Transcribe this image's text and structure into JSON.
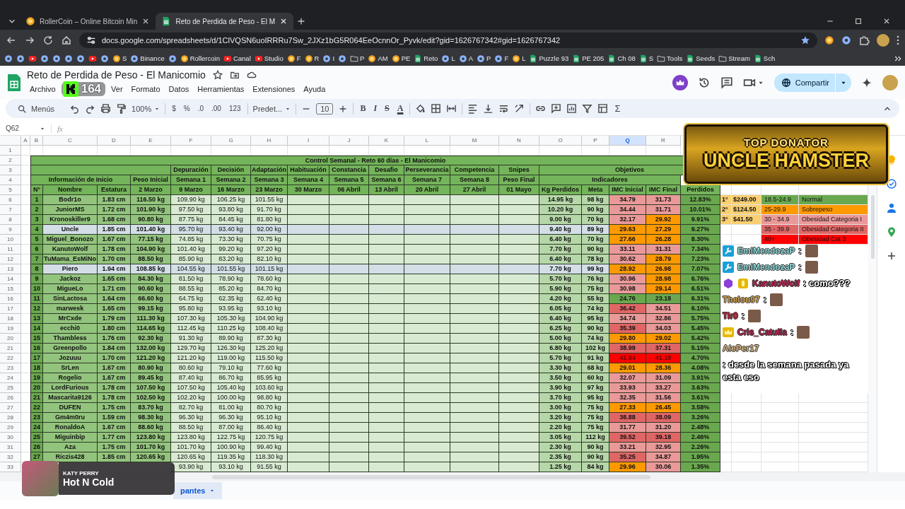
{
  "browser": {
    "tabs": [
      {
        "title": "RollerCoin – Online Bitcoin Min",
        "kind": "coin",
        "selected": false
      },
      {
        "title": "Reto de Perdida de Peso - El M",
        "kind": "sheet",
        "selected": true
      }
    ],
    "url": "docs.google.com/spreadsheets/d/1ClVQSN6uoIRRRu7Sw_2JXz1bG5R064EeOcnnOr_Pyvk/edit?gid=1626767342#gid=1626767342",
    "bookmarks": [
      {
        "kind": "site"
      },
      {
        "kind": "site"
      },
      {
        "kind": "video"
      },
      {
        "kind": "site"
      },
      {
        "kind": "site"
      },
      {
        "kind": "site"
      },
      {
        "kind": "site"
      },
      {
        "kind": "video"
      },
      {
        "kind": "site"
      },
      {
        "kind": "coin",
        "label": "S"
      },
      {
        "kind": "site",
        "label": "Binance"
      },
      {
        "kind": "site"
      },
      {
        "kind": "coin",
        "label": "Rollercoin"
      },
      {
        "kind": "video",
        "label": "Canal"
      },
      {
        "kind": "video",
        "label": "Studio"
      },
      {
        "kind": "coin",
        "label": "F"
      },
      {
        "kind": "coin",
        "label": "R"
      },
      {
        "kind": "site",
        "label": "I"
      },
      {
        "kind": "site"
      },
      {
        "kind": "folder",
        "label": "P"
      },
      {
        "kind": "coin",
        "label": "AM"
      },
      {
        "kind": "coin",
        "label": "PE"
      },
      {
        "kind": "sheet",
        "label": "Reto"
      },
      {
        "kind": "site",
        "label": "L"
      },
      {
        "kind": "site",
        "label": "A"
      },
      {
        "kind": "site",
        "label": "P"
      },
      {
        "kind": "site",
        "label": "F"
      },
      {
        "kind": "coin",
        "label": "L"
      },
      {
        "kind": "sheet",
        "label": "Puzzle 93"
      },
      {
        "kind": "sheet",
        "label": "PE 205"
      },
      {
        "kind": "sheet",
        "label": "Ch 08"
      },
      {
        "kind": "sheet",
        "label": "S"
      },
      {
        "kind": "folder",
        "label": "Tools"
      },
      {
        "kind": "sheet",
        "label": "Seeds"
      },
      {
        "kind": "folder",
        "label": "Stream"
      },
      {
        "kind": "sheet",
        "label": "Sch"
      }
    ]
  },
  "stream": {
    "viewer_count": "164"
  },
  "sheets": {
    "title": "Reto de Perdida de Peso - El Manicomio",
    "menus": [
      "Archivo",
      "Ver",
      "Formato",
      "Datos",
      "Herramientas",
      "Extensiones",
      "Ayuda"
    ],
    "share": "Compartir"
  },
  "toolbar": {
    "search": "Menús",
    "zoom": "100%",
    "number_formats": [
      "$",
      "%",
      ".0",
      ".00",
      "123"
    ],
    "font": "Predet...",
    "font_size": "10",
    "text_styles": [
      "B",
      "I",
      "S",
      "A"
    ],
    "sum": "Σ"
  },
  "formula_bar": {
    "cell_ref": "Q62",
    "fx": "fx"
  },
  "sheet": {
    "columns": [
      {
        "letter": "A",
        "selected": false
      },
      {
        "letter": "B",
        "selected": false
      },
      {
        "letter": "C",
        "selected": false
      },
      {
        "letter": "D",
        "selected": false
      },
      {
        "letter": "E",
        "selected": false
      },
      {
        "letter": "F",
        "selected": false
      },
      {
        "letter": "G",
        "selected": false
      },
      {
        "letter": "H",
        "selected": false
      },
      {
        "letter": "I",
        "selected": false
      },
      {
        "letter": "J",
        "selected": false
      },
      {
        "letter": "K",
        "selected": false
      },
      {
        "letter": "L",
        "selected": false
      },
      {
        "letter": "M",
        "selected": false
      },
      {
        "letter": "N",
        "selected": false
      },
      {
        "letter": "O",
        "selected": false
      },
      {
        "letter": "P",
        "selected": false
      },
      {
        "letter": "Q",
        "selected": true
      },
      {
        "letter": "R",
        "selected": false
      }
    ],
    "row_numbers": [
      "1",
      "2",
      "3",
      "4",
      "5",
      "6",
      "7",
      "8",
      "9",
      "10",
      "11",
      "12",
      "13",
      "14",
      "15",
      "16",
      "17",
      "18",
      "19",
      "20",
      "21",
      "22",
      "23",
      "24",
      "25",
      "26",
      "27",
      "28",
      "29",
      "30",
      "31",
      "32",
      "33"
    ],
    "title": "Control Semanal - Reto 60 días - El Manicomio",
    "stages": [
      "Depuración",
      "Decisión",
      "Adaptación",
      "Habituación",
      "Constancia",
      "Desafio",
      "Perseverancia",
      "Competencia",
      "Snipes"
    ],
    "objectives": "Objetivos",
    "info_header": "Información de Inicio",
    "start_header": "Peso Inicial",
    "weeks": [
      "Semana 1",
      "Semana 2",
      "Semana 3",
      "Semana 4",
      "Semana 5",
      "Semana 6",
      "Semana 7",
      "Semana 8",
      "Peso Final"
    ],
    "indicators": "Indicadores",
    "headers": [
      "N°",
      "Nombre",
      "Estatura",
      "2 Marzo",
      "9 Marzo",
      "16 Marzo",
      "23 Marzo",
      "30 Marzo",
      "06 Abril",
      "13 Abril",
      "20 Abril",
      "27 Abril",
      "01 Mayo",
      "Kg Perdidos",
      "Meta",
      "IMC Inicial",
      "IMC Final",
      "Perdidos"
    ],
    "players": [
      {
        "n": "1",
        "name": "Bodr1o",
        "height": "1.83 cm",
        "start": "116.50 kg",
        "weeks": [
          "109.90 kg",
          "106.25 kg",
          "101.55 kg"
        ],
        "lost": "14.95 kg",
        "goal": "98 kg",
        "bmi_start": {
          "value": "34.79",
          "color": "#ea9999"
        },
        "bmi_end": {
          "value": "31.73",
          "color": "#ea9999"
        },
        "pct": "12.83%",
        "highlighted": false
      },
      {
        "n": "2",
        "name": "JuniorMS",
        "height": "1.72 cm",
        "start": "101.90 kg",
        "weeks": [
          "97.50 kg",
          "93.80 kg",
          "91.70 kg"
        ],
        "lost": "10.20 kg",
        "goal": "90 kg",
        "bmi_start": {
          "value": "34.44",
          "color": "#ea9999"
        },
        "bmi_end": {
          "value": "31.71",
          "color": "#ea9999"
        },
        "pct": "10.01%",
        "highlighted": false
      },
      {
        "n": "3",
        "name": "Kronoskiller9",
        "height": "1.68 cm",
        "start": "90.80 kg",
        "weeks": [
          "87.75 kg",
          "84.45 kg",
          "81.80 kg"
        ],
        "lost": "9.00 kg",
        "goal": "70 kg",
        "bmi_start": {
          "value": "32.17",
          "color": "#ea9999"
        },
        "bmi_end": {
          "value": "29.92",
          "color": "#ff9900"
        },
        "pct": "9.91%",
        "highlighted": false
      },
      {
        "n": "4",
        "name": "Uncle",
        "height": "1.85 cm",
        "start": "101.40 kg",
        "weeks": [
          "95.70 kg",
          "93.40 kg",
          "92.00 kg"
        ],
        "lost": "9.40 kg",
        "goal": "89 kg",
        "bmi_start": {
          "value": "29.63",
          "color": "#ff9900"
        },
        "bmi_end": {
          "value": "27.29",
          "color": "#ff9900"
        },
        "pct": "9.27%",
        "highlighted": true
      },
      {
        "n": "5",
        "name": "Miguel_Bonozo",
        "height": "1.67 cm",
        "start": "77.15 kg",
        "weeks": [
          "74.85 kg",
          "73.30 kg",
          "70.75 kg"
        ],
        "lost": "6.40 kg",
        "goal": "70 kg",
        "bmi_start": {
          "value": "27.66",
          "color": "#ff9900"
        },
        "bmi_end": {
          "value": "26.28",
          "color": "#ff9900"
        },
        "pct": "8.30%",
        "highlighted": false
      },
      {
        "n": "6",
        "name": "KanutoWolf",
        "height": "1.78 cm",
        "start": "104.90 kg",
        "weeks": [
          "101.40 kg",
          "99.20 kg",
          "97.20 kg"
        ],
        "lost": "7.70 kg",
        "goal": "90 kg",
        "bmi_start": {
          "value": "33.11",
          "color": "#ea9999"
        },
        "bmi_end": {
          "value": "31.31",
          "color": "#ea9999"
        },
        "pct": "7.34%",
        "highlighted": false
      },
      {
        "n": "7",
        "name": "TuMama_EsMiNo",
        "height": "1.70 cm",
        "start": "88.50 kg",
        "weeks": [
          "85.90 kg",
          "83.20 kg",
          "82.10 kg"
        ],
        "lost": "6.40 kg",
        "goal": "78 kg",
        "bmi_start": {
          "value": "30.62",
          "color": "#ea9999"
        },
        "bmi_end": {
          "value": "28.79",
          "color": "#ff9900"
        },
        "pct": "7.23%",
        "highlighted": false
      },
      {
        "n": "8",
        "name": "Piero",
        "height": "1.94 cm",
        "start": "108.85 kg",
        "weeks": [
          "104.55 kg",
          "101.55 kg",
          "101.15 kg"
        ],
        "lost": "7.70 kg",
        "goal": "99 kg",
        "bmi_start": {
          "value": "28.92",
          "color": "#ff9900"
        },
        "bmi_end": {
          "value": "26.98",
          "color": "#ff9900"
        },
        "pct": "7.07%",
        "highlighted": true
      },
      {
        "n": "9",
        "name": "Jackoz",
        "height": "1.65 cm",
        "start": "84.30 kg",
        "weeks": [
          "81.50 kg",
          "78.90 kg",
          "78.60 kg"
        ],
        "lost": "5.70 kg",
        "goal": "76 kg",
        "bmi_start": {
          "value": "30.96",
          "color": "#ea9999"
        },
        "bmi_end": {
          "value": "28.98",
          "color": "#ff9900"
        },
        "pct": "6.76%",
        "highlighted": false
      },
      {
        "n": "10",
        "name": "MigueLo",
        "height": "1.71 cm",
        "start": "90.60 kg",
        "weeks": [
          "88.55 kg",
          "85.20 kg",
          "84.70 kg"
        ],
        "lost": "5.90 kg",
        "goal": "75 kg",
        "bmi_start": {
          "value": "30.98",
          "color": "#ea9999"
        },
        "bmi_end": {
          "value": "29.14",
          "color": "#ff9900"
        },
        "pct": "6.51%",
        "highlighted": false
      },
      {
        "n": "11",
        "name": "SinLactosa",
        "height": "1.64 cm",
        "start": "66.60 kg",
        "weeks": [
          "64.75 kg",
          "62.35 kg",
          "62.40 kg"
        ],
        "lost": "4.20 kg",
        "goal": "55 kg",
        "bmi_start": {
          "value": "24.76",
          "color": "#6aa84f"
        },
        "bmi_end": {
          "value": "23.18",
          "color": "#6aa84f"
        },
        "pct": "6.31%",
        "highlighted": false
      },
      {
        "n": "12",
        "name": "marwesk",
        "height": "1.65 cm",
        "start": "99.15 kg",
        "weeks": [
          "95.80 kg",
          "93.95 kg",
          "93.10 kg"
        ],
        "lost": "6.05 kg",
        "goal": "74 kg",
        "bmi_start": {
          "value": "36.42",
          "color": "#e06666"
        },
        "bmi_end": {
          "value": "34.51",
          "color": "#ea9999"
        },
        "pct": "6.10%",
        "highlighted": false
      },
      {
        "n": "13",
        "name": "MrCxde",
        "height": "1.79 cm",
        "start": "111.30 kg",
        "weeks": [
          "107.30 kg",
          "105.30 kg",
          "104.90 kg"
        ],
        "lost": "6.40 kg",
        "goal": "95 kg",
        "bmi_start": {
          "value": "34.74",
          "color": "#ea9999"
        },
        "bmi_end": {
          "value": "32.86",
          "color": "#ea9999"
        },
        "pct": "5.75%",
        "highlighted": false
      },
      {
        "n": "14",
        "name": "ecchi0",
        "height": "1.80 cm",
        "start": "114.65 kg",
        "weeks": [
          "112.45 kg",
          "110.25 kg",
          "108.40 kg"
        ],
        "lost": "6.25 kg",
        "goal": "90 kg",
        "bmi_start": {
          "value": "35.39",
          "color": "#e06666"
        },
        "bmi_end": {
          "value": "34.03",
          "color": "#ea9999"
        },
        "pct": "5.45%",
        "highlighted": false
      },
      {
        "n": "15",
        "name": "Thambless",
        "height": "1.76 cm",
        "start": "92.30 kg",
        "weeks": [
          "91.30 kg",
          "89.90 kg",
          "87.30 kg"
        ],
        "lost": "5.00 kg",
        "goal": "74 kg",
        "bmi_start": {
          "value": "29.80",
          "color": "#ff9900"
        },
        "bmi_end": {
          "value": "29.02",
          "color": "#ff9900"
        },
        "pct": "5.42%",
        "highlighted": false
      },
      {
        "n": "16",
        "name": "Greenpollo",
        "height": "1.84 cm",
        "start": "132.00 kg",
        "weeks": [
          "129.70 kg",
          "126.30 kg",
          "125.20 kg"
        ],
        "lost": "6.80 kg",
        "goal": "102 kg",
        "bmi_start": {
          "value": "38.99",
          "color": "#e06666"
        },
        "bmi_end": {
          "value": "37.31",
          "color": "#e06666"
        },
        "pct": "5.15%",
        "highlighted": false
      },
      {
        "n": "17",
        "name": "Jozuuu",
        "height": "1.70 cm",
        "start": "121.20 kg",
        "weeks": [
          "121.20 kg",
          "119.00 kg",
          "115.50 kg"
        ],
        "lost": "5.70 kg",
        "goal": "91 kg",
        "bmi_start": {
          "value": "41.94",
          "color": "#ff0000"
        },
        "bmi_end": {
          "value": "41.18",
          "color": "#ff0000"
        },
        "pct": "4.70%",
        "highlighted": false
      },
      {
        "n": "18",
        "name": "SrLen",
        "height": "1.67 cm",
        "start": "80.90 kg",
        "weeks": [
          "80.60 kg",
          "79.10 kg",
          "77.60 kg"
        ],
        "lost": "3.30 kg",
        "goal": "68 kg",
        "bmi_start": {
          "value": "29.01",
          "color": "#ff9900"
        },
        "bmi_end": {
          "value": "28.36",
          "color": "#ff9900"
        },
        "pct": "4.08%",
        "highlighted": false
      },
      {
        "n": "19",
        "name": "Rogelio",
        "height": "1.67 cm",
        "start": "89.45 kg",
        "weeks": [
          "87.40 kg",
          "86.70 kg",
          "85.95 kg"
        ],
        "lost": "3.50 kg",
        "goal": "60 kg",
        "bmi_start": {
          "value": "32.07",
          "color": "#ea9999"
        },
        "bmi_end": {
          "value": "31.09",
          "color": "#ea9999"
        },
        "pct": "3.91%",
        "highlighted": false
      },
      {
        "n": "20",
        "name": "LordFurious",
        "height": "1.78 cm",
        "start": "107.50 kg",
        "weeks": [
          "107.50 kg",
          "105.40 kg",
          "103.60 kg"
        ],
        "lost": "3.90 kg",
        "goal": "97 kg",
        "bmi_start": {
          "value": "33.93",
          "color": "#ea9999"
        },
        "bmi_end": {
          "value": "33.27",
          "color": "#ea9999"
        },
        "pct": "3.63%",
        "highlighted": false
      },
      {
        "n": "21",
        "name": "Mascarita9126",
        "height": "1.78 cm",
        "start": "102.50 kg",
        "weeks": [
          "102.20 kg",
          "100.00 kg",
          "98.80 kg"
        ],
        "lost": "3.70 kg",
        "goal": "95 kg",
        "bmi_start": {
          "value": "32.35",
          "color": "#ea9999"
        },
        "bmi_end": {
          "value": "31.56",
          "color": "#ea9999"
        },
        "pct": "3.61%",
        "highlighted": false
      },
      {
        "n": "22",
        "name": "DUFEN",
        "height": "1.75 cm",
        "start": "83.70 kg",
        "weeks": [
          "82.70 kg",
          "81.00 kg",
          "80.70 kg"
        ],
        "lost": "3.00 kg",
        "goal": "75 kg",
        "bmi_start": {
          "value": "27.33",
          "color": "#ff9900"
        },
        "bmi_end": {
          "value": "26.45",
          "color": "#ff9900"
        },
        "pct": "3.58%",
        "highlighted": false
      },
      {
        "n": "23",
        "name": "Gm4m0ru",
        "height": "1.59 cm",
        "start": "98.30 kg",
        "weeks": [
          "96.30 kg",
          "96.30 kg",
          "95.10 kg"
        ],
        "lost": "3.20 kg",
        "goal": "75 kg",
        "bmi_start": {
          "value": "38.88",
          "color": "#e06666"
        },
        "bmi_end": {
          "value": "38.09",
          "color": "#e06666"
        },
        "pct": "3.26%",
        "highlighted": false
      },
      {
        "n": "24",
        "name": "RonaldoA",
        "height": "1.67 cm",
        "start": "88.60 kg",
        "weeks": [
          "88.50 kg",
          "87.00 kg",
          "86.40 kg"
        ],
        "lost": "2.20 kg",
        "goal": "75 kg",
        "bmi_start": {
          "value": "31.77",
          "color": "#ea9999"
        },
        "bmi_end": {
          "value": "31.20",
          "color": "#ea9999"
        },
        "pct": "2.48%",
        "highlighted": false
      },
      {
        "n": "25",
        "name": "Miguinbip",
        "height": "1.77 cm",
        "start": "123.80 kg",
        "weeks": [
          "123.80 kg",
          "122.75 kg",
          "120.75 kg"
        ],
        "lost": "3.05 kg",
        "goal": "112 kg",
        "bmi_start": {
          "value": "39.52",
          "color": "#e06666"
        },
        "bmi_end": {
          "value": "39.18",
          "color": "#e06666"
        },
        "pct": "2.46%",
        "highlighted": false
      },
      {
        "n": "26",
        "name": "Aza",
        "height": "1.75 cm",
        "start": "101.70 kg",
        "weeks": [
          "101.70 kg",
          "100.90 kg",
          "99.40 kg"
        ],
        "lost": "2.30 kg",
        "goal": "90 kg",
        "bmi_start": {
          "value": "33.21",
          "color": "#ea9999"
        },
        "bmi_end": {
          "value": "32.95",
          "color": "#ea9999"
        },
        "pct": "2.26%",
        "highlighted": false
      },
      {
        "n": "27",
        "name": "Riczis428",
        "height": "1.85 cm",
        "start": "120.65 kg",
        "weeks": [
          "120.65 kg",
          "119.35 kg",
          "118.30 kg"
        ],
        "lost": "2.35 kg",
        "goal": "90 kg",
        "bmi_start": {
          "value": "35.25",
          "color": "#e06666"
        },
        "bmi_end": {
          "value": "34.87",
          "color": "#ea9999"
        },
        "pct": "1.95%",
        "highlighted": false
      },
      {
        "weeks": [
          "93.90 kg",
          "93.10 kg",
          "91.55 kg"
        ],
        "lost": "1.25 kg",
        "goal": "84 kg",
        "bmi_start": {
          "value": "29.96",
          "color": "#ff9900"
        },
        "bmi_end": {
          "value": "30.06",
          "color": "#ea9999"
        },
        "pct": "1.35%",
        "highlighted": false
      }
    ],
    "prizes": [
      {
        "place": "1°",
        "amount": "$249.00"
      },
      {
        "place": "2°",
        "amount": "$124.50"
      },
      {
        "place": "3°",
        "amount": "$41.50"
      }
    ],
    "bmi_legend": [
      {
        "range": "18.5-24.9",
        "label": "Normal",
        "color": "#6aa84f"
      },
      {
        "range": "25-29.9",
        "label": "Sobrepeso",
        "color": "#ff9900"
      },
      {
        "range": "30 - 34.9",
        "label": "Obesidad Categoria I",
        "color": "#ea9999"
      },
      {
        "range": "35 - 39.9",
        "label": "Obesidad Categoria II",
        "color": "#e06666"
      },
      {
        "range": "40+",
        "label": "Obesidad Cat 3",
        "color": "#ff0000"
      }
    ]
  },
  "banner": {
    "kicker": "TOP DONATOR",
    "name": "UNCLE HAMSTER"
  },
  "chat": [
    {
      "user": "EmiMendozaP",
      "text": ":",
      "color": "#8fd8d8",
      "badges": [
        {
          "kind": "wrench"
        }
      ],
      "emote": true
    },
    {
      "user": "EmiMendozaP",
      "text": ":",
      "color": "#8fd8d8",
      "badges": [
        {
          "kind": "wrench"
        }
      ],
      "emote": true
    },
    {
      "user": "KanutoWolf",
      "text": ": como???",
      "color": "#b3254f",
      "badges": [
        {
          "kind": "gem"
        },
        {
          "kind": "coin"
        }
      ],
      "emote": false
    },
    {
      "user": "Thelou97",
      "text": ":",
      "color": "#d9a650",
      "emote": true
    },
    {
      "user": "Tir0",
      "text": ":",
      "color": "#c0263f",
      "emote": true
    },
    {
      "user": "Cris_Catulla",
      "text": ":",
      "color": "#b4234d",
      "badges": [
        {
          "kind": "crown"
        }
      ],
      "emote": true
    },
    {
      "user": "AlePer17",
      "text": ": desde la semana pasada ya esta eso",
      "color": "#d8b985",
      "emote": false
    }
  ],
  "now_playing": {
    "artist": "KATY PERRY",
    "song": "Hot N Cold"
  },
  "sheet_tabs": [
    {
      "label": "pantes",
      "selected": true
    }
  ]
}
